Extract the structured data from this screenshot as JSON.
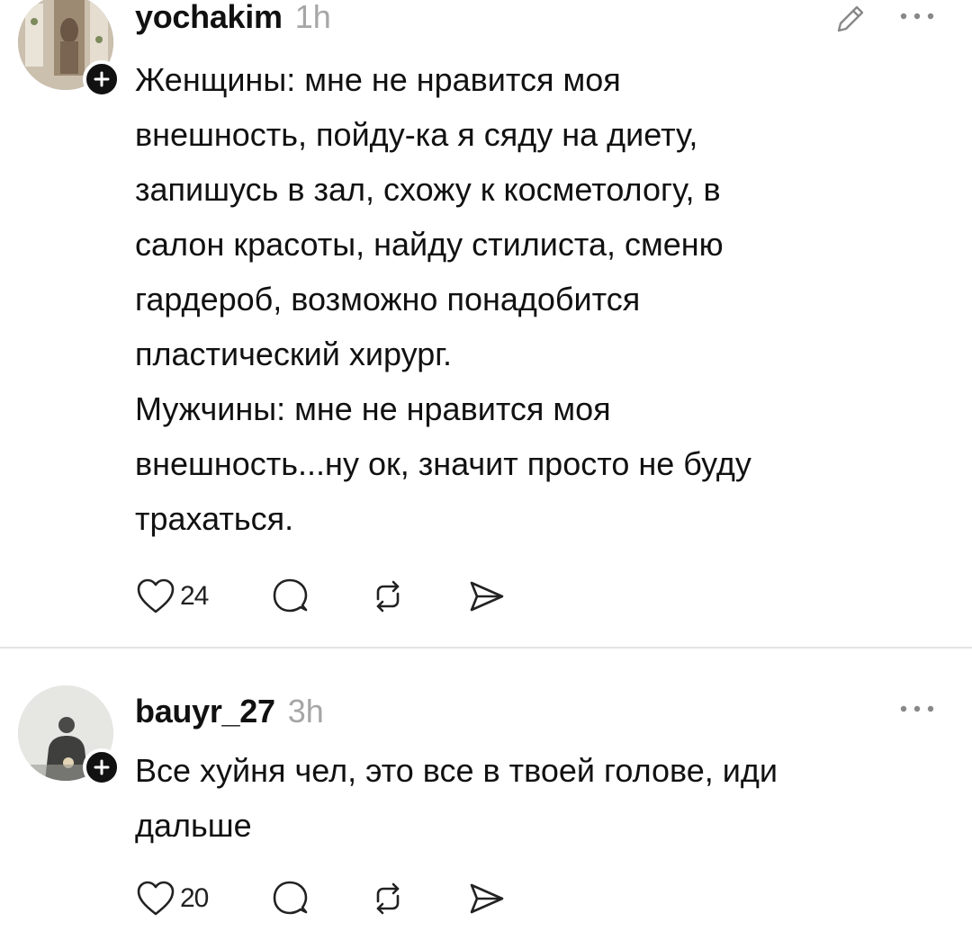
{
  "posts": [
    {
      "username": "yochakim",
      "time": "1h",
      "text": "Женщины: мне не нравится моя\nвнешность, пойду-ка я сяду на диету,\nзапишусь в зал, схожу к косметологу, в\nсалон красоты, найду стилиста, сменю\nгардероб, возможно понадобится\nпластический хирург.\nМужчины: мне не нравится моя\nвнешность...ну ок, значит просто не буду\nтрахаться.",
      "likes": "24",
      "icons": [
        "avatar",
        "plus-icon",
        "pencil-icon",
        "more-icon",
        "heart-icon",
        "comment-icon",
        "repost-icon",
        "share-icon"
      ]
    },
    {
      "username": "bauyr_27",
      "time": "3h",
      "text": "Все хуйня чел, это все в твоей голове, иди\nдальше",
      "likes": "20",
      "icons": [
        "avatar",
        "plus-icon",
        "more-icon",
        "heart-icon",
        "comment-icon",
        "repost-icon",
        "share-icon"
      ]
    }
  ],
  "colors": {
    "text": "#111111",
    "muted": "#a6a6a6",
    "divider": "#e4e4e4",
    "background": "#ffffff"
  }
}
